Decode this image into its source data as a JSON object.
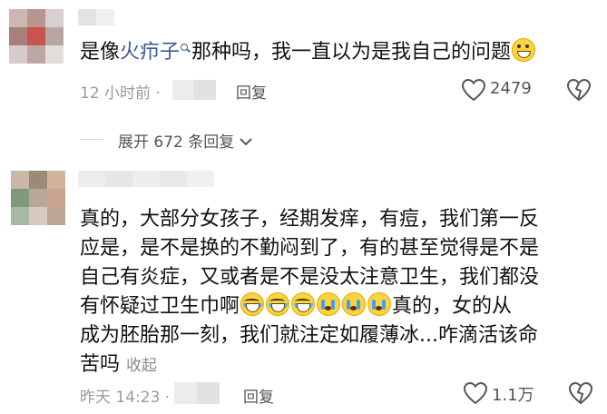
{
  "comment1": {
    "text_before_link": "是像",
    "link_text": "火疖子",
    "text_after_link": "那种吗，我一直以为是我自己的问题",
    "emoji": "grin-emoji",
    "time": "12 小时前 ·",
    "reply_label": "回复",
    "like_count": "2479"
  },
  "expand": {
    "label": "展开 672 条回复"
  },
  "comment2": {
    "lines": [
      "真的，大部分女孩子，经期发痒，有痘，我们第一反",
      "应是，是不是换的不勤闷到了，有的甚至觉得是不是",
      "自己有炎症，又或者是不是没太注意卫生，我们都没"
    ],
    "line4_before_emoji": "有怀疑过卫生巾啊",
    "line4_emojis": [
      "laugh-emoji",
      "laugh-emoji",
      "laugh-emoji",
      "cry-emoji",
      "cry-emoji",
      "cry-emoji"
    ],
    "line4_after_emoji": "真的，女的从",
    "line5": "成为胚胎那一刻，我们就注定如履薄冰...咋滴活该命",
    "line6": "苦吗",
    "collapse_label": "收起",
    "time": "昨天 14:23 ·",
    "reply_label": "回复",
    "like_count": "1.1万"
  }
}
